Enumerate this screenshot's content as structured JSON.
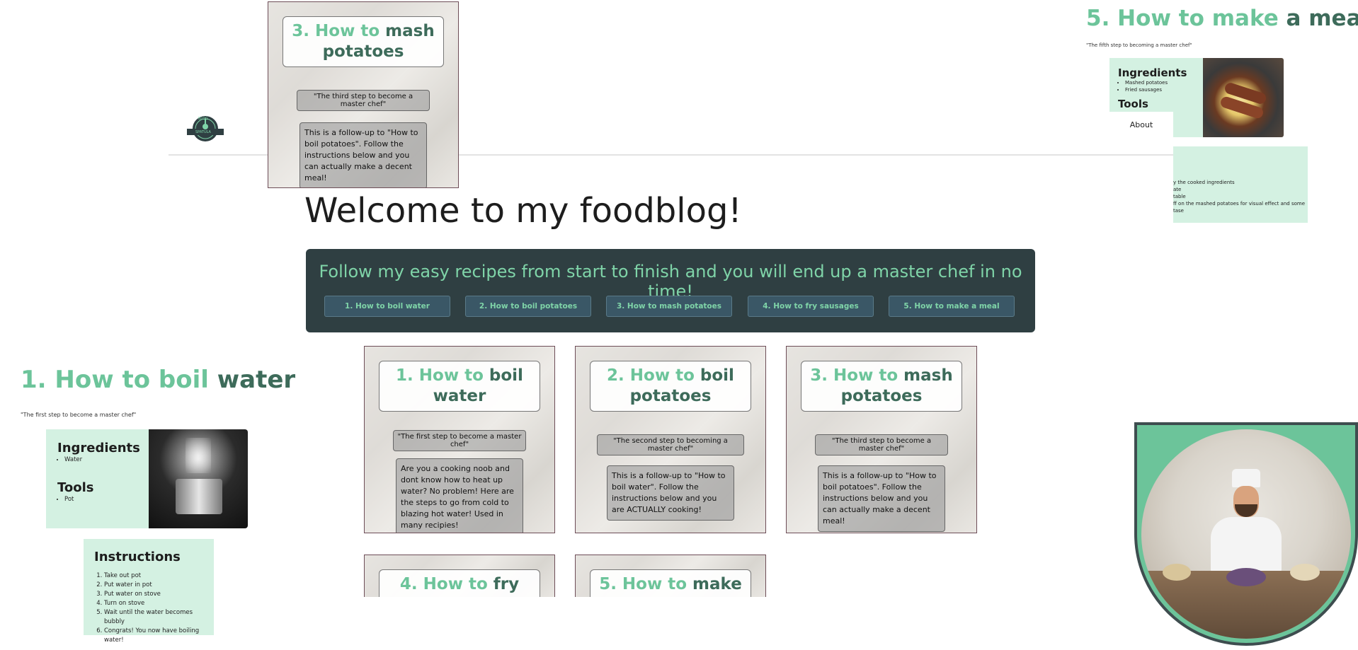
{
  "nav": {
    "about": "About"
  },
  "logo": {
    "text_top": "BLOG",
    "text_bottom": "SPATULA"
  },
  "main": {
    "welcome": "Welcome to my foodblog!",
    "banner_text": "Follow my easy recipes from start to finish and you will end up a master chef in no time!",
    "buttons": [
      "1. How to boil water",
      "2. How to boil potatoes",
      "3. How to mash potatoes",
      "4. How to fry sausages",
      "5. How to make a meal"
    ]
  },
  "cards": [
    {
      "title_a": "1. How to ",
      "title_b": "boil water",
      "quote": "\"The first step to become a master chef\"",
      "desc": "Are you a cooking noob and dont know how to heat up water? No problem! Here are the steps to go from cold to blazing hot water! Used in many recipies!"
    },
    {
      "title_a": "2. How to ",
      "title_b": "boil potatoes",
      "quote": "\"The second step to becoming a master chef\"",
      "desc": "This is a follow-up to \"How to boil water\". Follow the instructions below and you are ACTUALLY cooking!"
    },
    {
      "title_a": "3. How to ",
      "title_b": "mash potatoes",
      "quote": "\"The third step to become a master chef\"",
      "desc": "This is a follow-up to \"How to boil potatoes\". Follow the instructions below and you can actually make a decent meal!"
    },
    {
      "title_a": "4. How to ",
      "title_b": "fry"
    },
    {
      "title_a": "5. How to ",
      "title_b": "make a"
    }
  ],
  "floating_card": {
    "title_a": "3. How to ",
    "title_b": "mash potatoes",
    "quote": "\"The third step to become a master chef\"",
    "desc": "This is a follow-up to \"How to boil potatoes\". Follow the instructions below and you can actually make a decent meal!"
  },
  "section1": {
    "title_a": "1. How to boil ",
    "title_b": "water",
    "subtitle": "\"The first step to become a master chef\"",
    "ingredients_label": "Ingredients",
    "ingredients": [
      "Water"
    ],
    "tools_label": "Tools",
    "tools": [
      "Pot"
    ],
    "instructions_label": "Instructions",
    "instructions": [
      "Take out pot",
      "Put water in pot",
      "Put water on stove",
      "Turn on stove",
      "Wait until the water becomes bubbly",
      "Congrats! You now have boiling water!"
    ]
  },
  "section5": {
    "title_a": "5. How to make ",
    "title_b": "a meal",
    "subtitle": "\"The fifth step to becoming a master chef\"",
    "ingredients_label": "Ingredients",
    "ingredients": [
      "Mashed potatoes",
      "Fried sausages"
    ],
    "tools_label": "Tools",
    "instructions_partial": [
      "y the cooked ingredients",
      "ate",
      "table",
      "ff on the mashed potatoes for visual effect and some tase"
    ]
  },
  "colors": {
    "accent_green": "#6cc49a",
    "dark_green": "#3d6b5a",
    "banner_bg": "#2f3f42",
    "mint": "#d4f1e2",
    "button_bg": "#3a5766"
  }
}
